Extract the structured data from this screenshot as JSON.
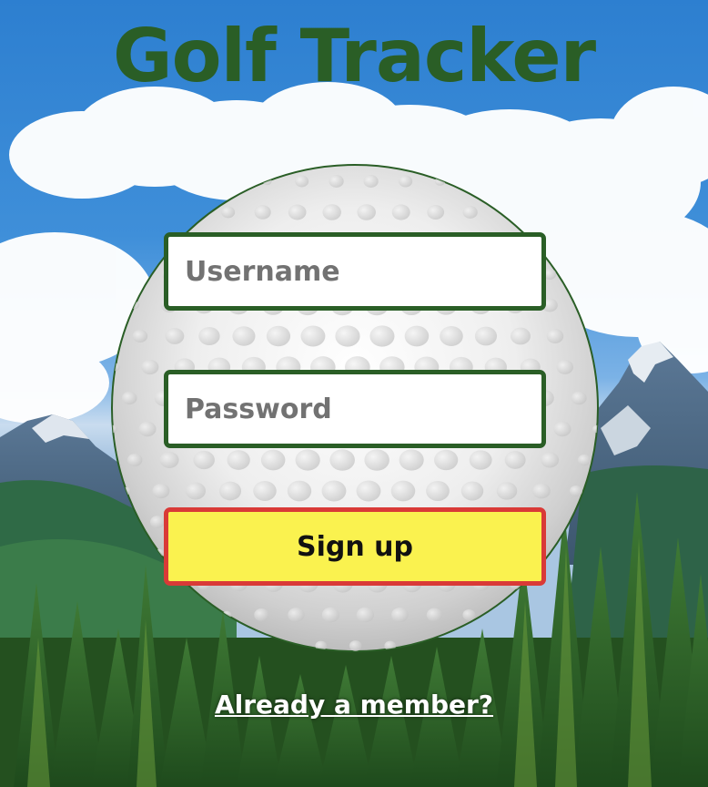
{
  "app": {
    "title": "Golf Tracker"
  },
  "form": {
    "username_placeholder": "Username",
    "username_value": "",
    "password_placeholder": "Password",
    "password_value": "",
    "submit_label": "Sign up"
  },
  "footer": {
    "member_link_label": "Already a member?"
  },
  "colors": {
    "title": "#2a5e26",
    "field_border": "#2a5e26",
    "button_fill": "#faf24f",
    "button_border": "#d93a37",
    "sky": "#3f8fd9"
  },
  "icons": {
    "background": "mountain-forest-landscape",
    "emblem": "golf-ball-icon"
  }
}
